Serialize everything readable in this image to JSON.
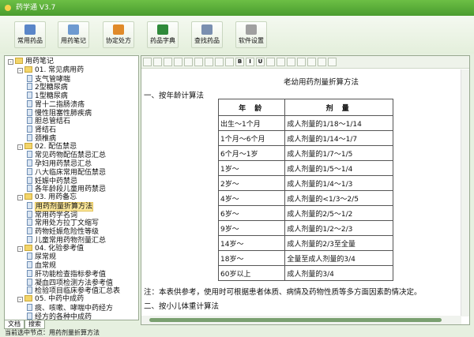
{
  "window": {
    "title": "药学通 V3.7"
  },
  "toolbar": [
    "常用药品",
    "用药笔记",
    "协定处方",
    "药品字典",
    "查找药品",
    "软件设置"
  ],
  "tree": [
    {
      "label": "用药笔记",
      "level": 0,
      "type": "folder"
    },
    {
      "label": "01. 常见病用药",
      "level": 1,
      "type": "folder"
    },
    {
      "label": "支气管哮喘",
      "level": 2
    },
    {
      "label": "2型糖尿病",
      "level": 2
    },
    {
      "label": "1型糖尿病",
      "level": 2
    },
    {
      "label": "胃十二指肠溃疡",
      "level": 2
    },
    {
      "label": "慢性阻塞性肺疾病",
      "level": 2
    },
    {
      "label": "胆总管结石",
      "level": 2
    },
    {
      "label": "肾结石",
      "level": 2
    },
    {
      "label": "颈椎病",
      "level": 2
    },
    {
      "label": "02. 配伍禁忌",
      "level": 1,
      "type": "folder"
    },
    {
      "label": "常见药物配伍禁忌汇总",
      "level": 2
    },
    {
      "label": "孕妇用药禁忌汇总",
      "level": 2
    },
    {
      "label": "八大临床常用配伍禁忌",
      "level": 2
    },
    {
      "label": "妊娠中药禁忌",
      "level": 2
    },
    {
      "label": "各年龄段儿童用药禁忌",
      "level": 2
    },
    {
      "label": "03. 用药备忘",
      "level": 1,
      "type": "folder"
    },
    {
      "label": "用药剂量折算方法",
      "level": 2,
      "selected": true
    },
    {
      "label": "常用药学名词",
      "level": 2
    },
    {
      "label": "常用处方拉丁文缩写",
      "level": 2
    },
    {
      "label": "药物妊娠危险性等级",
      "level": 2
    },
    {
      "label": "儿童常用药物剂量汇总",
      "level": 2
    },
    {
      "label": "04. 化验参考值",
      "level": 1,
      "type": "folder"
    },
    {
      "label": "尿常规",
      "level": 2
    },
    {
      "label": "血常规",
      "level": 2
    },
    {
      "label": "肝功能检查指标参考值",
      "level": 2
    },
    {
      "label": "凝血四项检测方法参考值",
      "level": 2
    },
    {
      "label": "检验项目临床参考值汇总表",
      "level": 2
    },
    {
      "label": "05. 中药中成药",
      "level": 1,
      "type": "folder"
    },
    {
      "label": "痰、咳嗽、哮喘中药经方",
      "level": 2
    },
    {
      "label": "经方的各种中成药",
      "level": 2
    }
  ],
  "tabs": [
    "文档",
    "搜索"
  ],
  "status": "当前选中节点：用药剂量折算方法",
  "doc": {
    "title": "老幼用药剂量折算方法",
    "section1": "一、按年龄计算法",
    "headers": [
      "年 龄",
      "剂 量"
    ],
    "rows": [
      [
        "出生～1个月",
        "成人剂量的1/18～1/14"
      ],
      [
        "1个月～6个月",
        "成人剂量的1/14～1/7"
      ],
      [
        "6个月～1岁",
        "成人剂量的1/7～1/5"
      ],
      [
        "1岁～",
        "成人剂量的1/5～1/4"
      ],
      [
        "2岁～",
        "成人剂量的1/4～1/3"
      ],
      [
        "4岁～",
        "成人剂量的<1/3～2/5"
      ],
      [
        "6岁～",
        "成人剂量的2/5～1/2"
      ],
      [
        "9岁～",
        "成人剂量的1/2～2/3"
      ],
      [
        "14岁～",
        "成人剂量的2/3至全量"
      ],
      [
        "18岁～",
        "全量至成人剂量的3/4"
      ],
      [
        "60岁以上",
        "成人剂量的3/4"
      ]
    ],
    "note": "注：本表供参考，使用时可根据患者体质、病情及药物性质等多方面因素酌情决定。",
    "section2": "二、按小儿体重计算法"
  },
  "editor_tools": [
    "save",
    "open",
    "preview",
    "find",
    "hr",
    "line",
    "align-left",
    "align-center",
    "align-right",
    "B",
    "I",
    "U",
    "image",
    "paint",
    "picture",
    "media",
    "table",
    "clear",
    "undo"
  ],
  "colors": {
    "accent": "#4a9c2e"
  }
}
